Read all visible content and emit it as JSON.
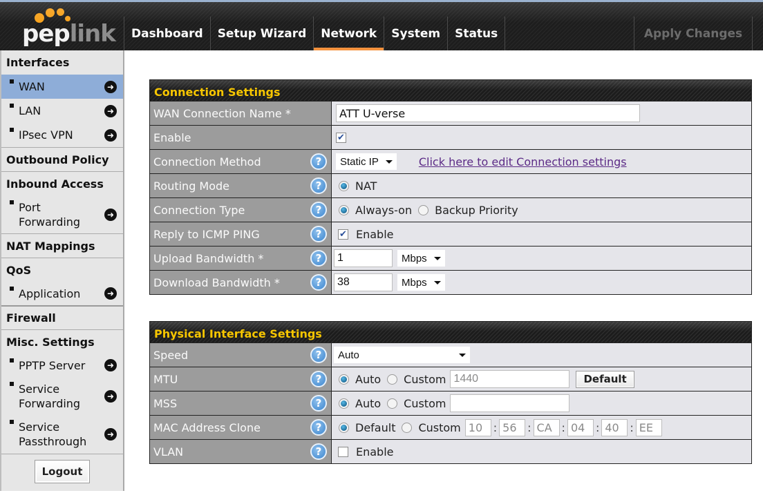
{
  "header": {
    "logo": {
      "part1": "pep",
      "part2": "link"
    },
    "nav": [
      {
        "label": "Dashboard",
        "active": false
      },
      {
        "label": "Setup Wizard",
        "active": false
      },
      {
        "label": "Network",
        "active": true
      },
      {
        "label": "System",
        "active": false
      },
      {
        "label": "Status",
        "active": false
      }
    ],
    "apply_changes": "Apply Changes",
    "accent_color": "#f5923e"
  },
  "sidebar": {
    "interfaces": "Interfaces",
    "wan": "WAN",
    "lan": "LAN",
    "ipsec_vpn": "IPsec VPN",
    "outbound_policy": "Outbound Policy",
    "inbound_access": "Inbound Access",
    "port_forwarding": "Port Forwarding",
    "nat_mappings": "NAT Mappings",
    "qos": "QoS",
    "application": "Application",
    "firewall": "Firewall",
    "misc_settings": "Misc. Settings",
    "pptp_server": "PPTP Server",
    "service_forwarding": "Service Forwarding",
    "service_passthrough": "Service Passthrough",
    "logout": "Logout",
    "selected_item": "WAN",
    "arrow_icon": "arrow-right-circle-icon"
  },
  "connection_settings": {
    "title": "Connection Settings",
    "wan_name_label": "WAN Connection Name *",
    "wan_name_value": "ATT U-verse",
    "enable_label": "Enable",
    "enable_checked": true,
    "method_label": "Connection Method",
    "method_value": "Static IP",
    "method_link": "Click here to edit Connection settings",
    "routing_label": "Routing Mode",
    "routing_option": "NAT",
    "conn_type_label": "Connection Type",
    "conn_type_always_on": "Always-on",
    "conn_type_backup": "Backup Priority",
    "conn_type_selected": "Always-on",
    "icmp_label": "Reply to ICMP PING",
    "icmp_option": "Enable",
    "icmp_checked": true,
    "upload_label": "Upload Bandwidth *",
    "upload_value": "1",
    "upload_unit": "Mbps",
    "download_label": "Download Bandwidth *",
    "download_value": "38",
    "download_unit": "Mbps"
  },
  "physical_settings": {
    "title": "Physical Interface Settings",
    "speed_label": "Speed",
    "speed_value": "Auto",
    "mtu_label": "MTU",
    "mtu_auto": "Auto",
    "mtu_custom": "Custom",
    "mtu_value": "1440",
    "mtu_selected": "Auto",
    "mtu_default_button": "Default",
    "mss_label": "MSS",
    "mss_auto": "Auto",
    "mss_custom": "Custom",
    "mss_value": "",
    "mss_selected": "Auto",
    "mac_label": "MAC Address Clone",
    "mac_default": "Default",
    "mac_custom": "Custom",
    "mac_selected": "Default",
    "mac_octets": [
      "10",
      "56",
      "CA",
      "04",
      "40",
      "EE"
    ],
    "vlan_label": "VLAN",
    "vlan_option": "Enable",
    "vlan_checked": false
  }
}
